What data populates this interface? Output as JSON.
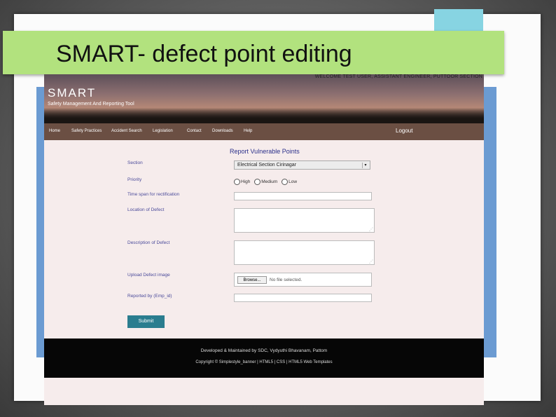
{
  "slide": {
    "title": "SMART- defect point editing"
  },
  "site": {
    "welcome": "WELCOME TEST USER, ASSISTANT ENGINEER, PUTTOOR SECTION",
    "logo": "SMART",
    "tagline": "Safety Management And Reporting Tool",
    "nav": [
      "Home",
      "Safety Practices",
      "Accident Search",
      "Legislation",
      "Contact",
      "Downloads",
      "Help"
    ],
    "logout": "Logout"
  },
  "form": {
    "title": "Report Vulnerable Points",
    "section_label": "Section",
    "section_value": "Electrical Section Cirinagar",
    "priority_label": "Priority",
    "priority_options": [
      "High",
      "Medium",
      "Low"
    ],
    "timespan_label": "Time span for rectification",
    "location_label": "Location of Defect",
    "description_label": "Description of Defect",
    "upload_label": "Upload Defect image",
    "browse_label": "Browse...",
    "no_file": "No file selected.",
    "reported_by_label": "Reported by (Emp_id)",
    "submit_label": "Submit"
  },
  "footer": {
    "line1": "Developed & Maintained by SDC, Vydyuthi Bhavanam, Pattom",
    "line2": "Copyright © Simplestyle_banner | HTML5 | CSS | HTML5 Web Templates"
  },
  "colors": {
    "title_bar": "#b2e27e",
    "nav_bar": "#6b4f43",
    "submit": "#2a7d8f",
    "form_title": "#2b2f8a"
  }
}
